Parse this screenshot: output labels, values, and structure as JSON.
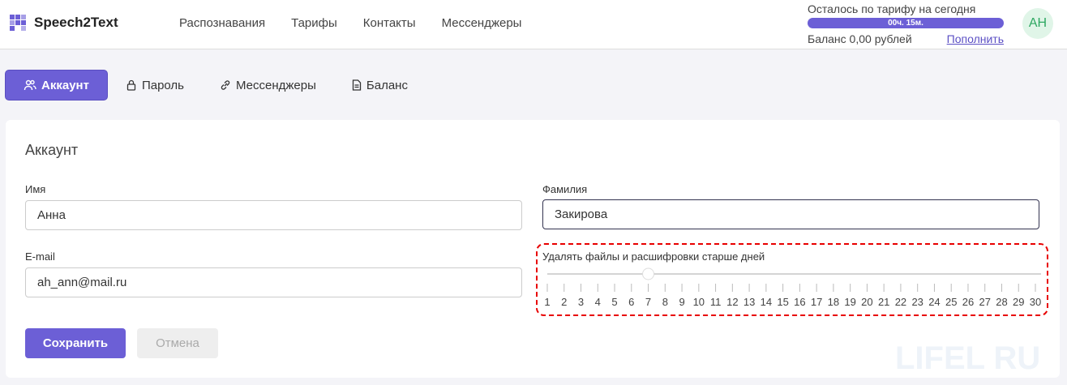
{
  "header": {
    "brand": "Speech2Text",
    "nav": [
      "Распознавания",
      "Тарифы",
      "Контакты",
      "Мессенджеры"
    ],
    "quota_label": "Осталось по тарифу на сегодня",
    "quota_value": "00ч. 15м.",
    "balance": "Баланс 0,00 рублей",
    "topup": "Пополнить",
    "avatar": "АН"
  },
  "tabs": [
    {
      "label": "Аккаунт",
      "icon": "users-icon"
    },
    {
      "label": "Пароль",
      "icon": "lock-icon"
    },
    {
      "label": "Мессенджеры",
      "icon": "link-icon"
    },
    {
      "label": "Баланс",
      "icon": "document-icon"
    }
  ],
  "form": {
    "title": "Аккаунт",
    "first_name_label": "Имя",
    "first_name": "Анна",
    "last_name_label": "Фамилия",
    "last_name": "Закирова",
    "email_label": "E-mail",
    "email": "ah_ann@mail.ru",
    "slider_label": "Удалять файлы и расшифровки старше дней",
    "slider_value": 7,
    "slider_min": 1,
    "slider_max": 30,
    "save": "Сохранить",
    "cancel": "Отмена"
  },
  "colors": {
    "accent": "#6c5fd6",
    "highlight": "#e80000"
  },
  "watermark": "LIFEL RU"
}
